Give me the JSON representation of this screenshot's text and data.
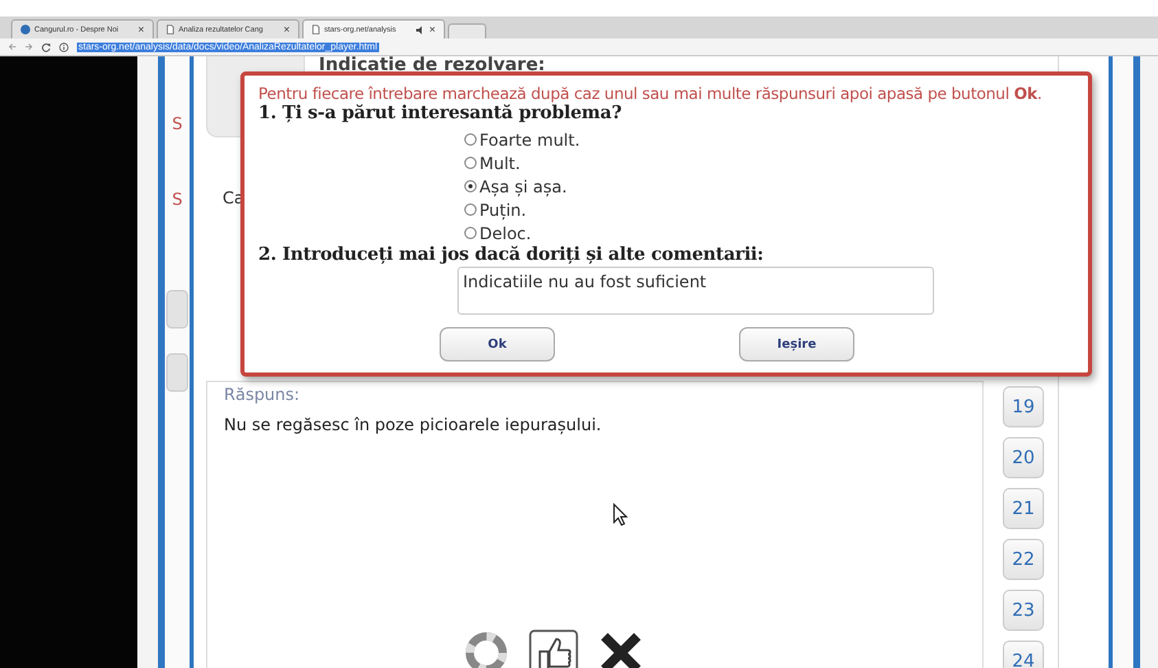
{
  "browser": {
    "tabs": [
      {
        "title": "Cangurul.ro - Despre Noi",
        "close": "×",
        "selected": false
      },
      {
        "title": "Analiza rezultatelor Cang",
        "close": "×",
        "selected": false
      },
      {
        "title": "stars-org.net/analysis",
        "close": "×",
        "selected": true
      }
    ],
    "address": {
      "url": "stars-org.net/analysis/data/docs/video/AnalizaRezultatelor_player.html"
    }
  },
  "page": {
    "hint_title": "Indicatie de rezolvare:",
    "side_letters": [
      "S",
      "S"
    ],
    "partial_label": "Ca",
    "answer_label": "Răspuns:",
    "answer_text": "Nu se regăsesc în poze picioarele iepurașului.",
    "question_numbers": [
      "19",
      "20",
      "21",
      "22",
      "23",
      "24"
    ]
  },
  "dialog": {
    "instruction": "Pentru fiecare întrebare marchează după caz unul sau mai multe răspunsuri apoi apasă pe butonul **Ok**.",
    "question_1": "1. Ți s-a părut interesantă problema?",
    "options": [
      {
        "label": "Foarte mult.",
        "selected": false
      },
      {
        "label": "Mult.",
        "selected": false
      },
      {
        "label": "Așa și așa.",
        "selected": true
      },
      {
        "label": "Puțin.",
        "selected": false
      },
      {
        "label": "Deloc.",
        "selected": false
      }
    ],
    "question_2": "2. Introduceți mai jos dacă doriți și alte comentarii:",
    "comment": {
      "value": "Indicatiile nu au fost suficient"
    },
    "buttons": [
      "Ok",
      "Ieșire"
    ]
  }
}
